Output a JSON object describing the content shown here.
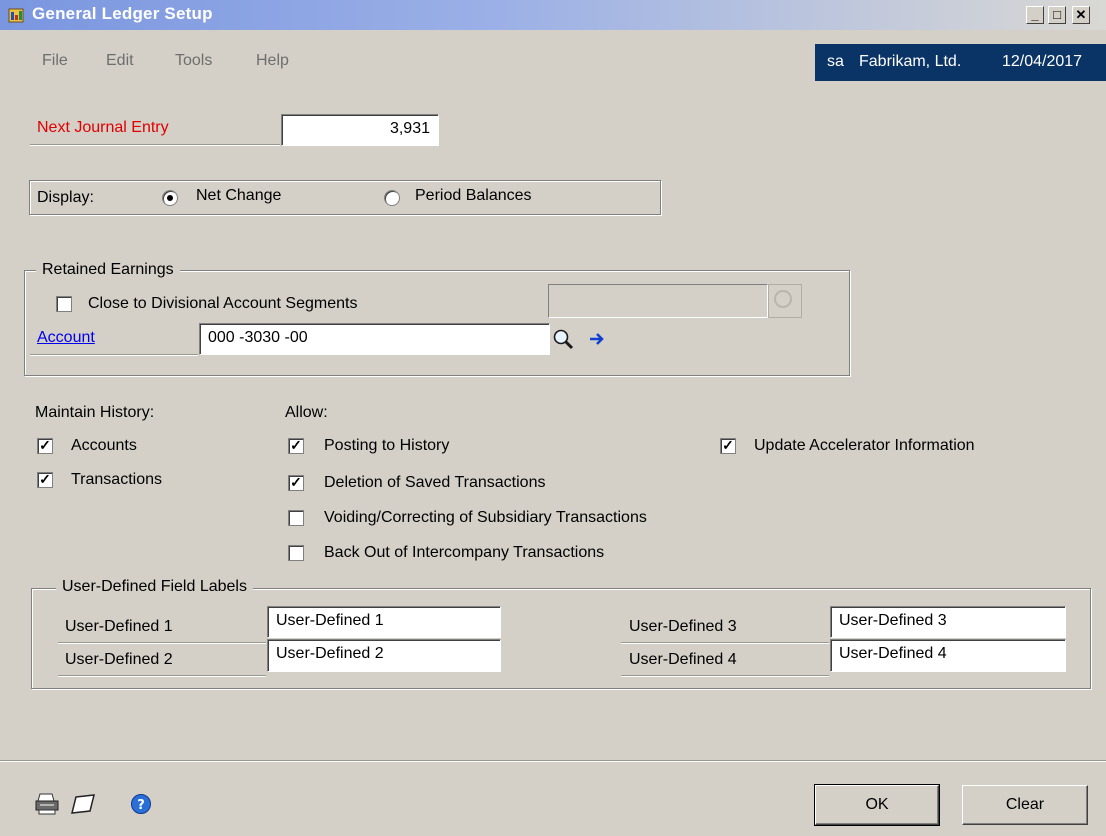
{
  "window": {
    "title": "General Ledger Setup"
  },
  "menu": [
    "File",
    "Edit",
    "Tools",
    "Help"
  ],
  "userbar": {
    "user": "sa",
    "company": "Fabrikam, Ltd.",
    "date": "12/04/2017"
  },
  "next_journal_entry": {
    "label": "Next Journal Entry",
    "value": "3,931"
  },
  "display": {
    "label": "Display:",
    "options": [
      {
        "label": "Net Change",
        "selected": true
      },
      {
        "label": "Period Balances",
        "selected": false
      }
    ]
  },
  "retained_earnings": {
    "title": "Retained Earnings",
    "close_divisional": {
      "label": "Close to Divisional Account Segments",
      "checked": false
    },
    "account_label": "Account",
    "account_value": "000 -3030 -00"
  },
  "maintain_history": {
    "title": "Maintain History:",
    "items": [
      {
        "label": "Accounts",
        "checked": true
      },
      {
        "label": "Transactions",
        "checked": true
      }
    ]
  },
  "allow": {
    "title": "Allow:",
    "items": [
      {
        "label": "Posting to History",
        "checked": true
      },
      {
        "label": "Deletion of Saved Transactions",
        "checked": true
      },
      {
        "label": "Voiding/Correcting of Subsidiary Transactions",
        "checked": false
      },
      {
        "label": "Back Out of Intercompany Transactions",
        "checked": false
      }
    ],
    "accelerator": {
      "label": "Update Accelerator Information",
      "checked": true
    }
  },
  "user_defined": {
    "title": "User-Defined Field Labels",
    "fields": [
      {
        "label": "User-Defined 1",
        "value": "User-Defined 1"
      },
      {
        "label": "User-Defined 2",
        "value": "User-Defined 2"
      },
      {
        "label": "User-Defined 3",
        "value": "User-Defined 3"
      },
      {
        "label": "User-Defined 4",
        "value": "User-Defined 4"
      }
    ]
  },
  "buttons": {
    "ok": "OK",
    "clear": "Clear"
  },
  "icons": [
    "printer-icon",
    "note-icon",
    "help-icon",
    "lookup-icon",
    "expansion-arrow-icon"
  ],
  "colors": {
    "title_gradient": "#7a96df",
    "userbar": "#0a3466",
    "required_label": "#e00000",
    "link": "#0000ee"
  }
}
